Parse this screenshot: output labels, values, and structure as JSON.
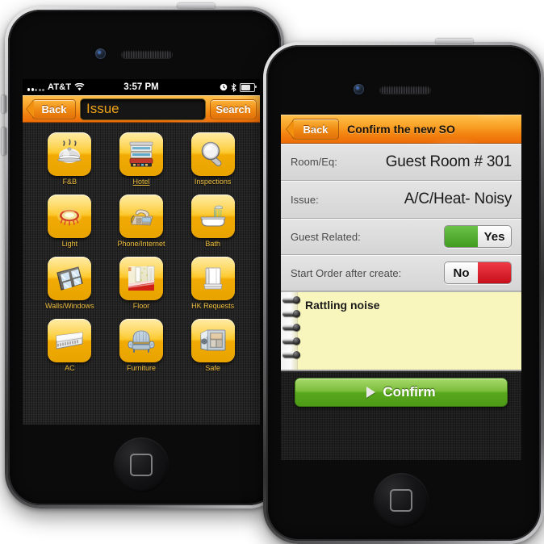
{
  "left_phone": {
    "status_bar": {
      "signal_icon": "signal-bars-icon",
      "carrier": "AT&T",
      "wifi_icon": "wifi-icon",
      "time": "3:57 PM",
      "alarm_icon": "alarm-clock-icon",
      "bluetooth_icon": "bluetooth-icon",
      "battery_icon": "battery-icon"
    },
    "nav": {
      "back_label": "Back",
      "search_value": "Issue",
      "search_placeholder": "Issue",
      "search_label": "Search"
    },
    "grid": [
      {
        "label": "F&B",
        "icon": "food-cloche-icon",
        "selected": false
      },
      {
        "label": "Hotel",
        "icon": "hotel-bed-icon",
        "selected": true
      },
      {
        "label": "Inspections",
        "icon": "magnifier-icon",
        "selected": false
      },
      {
        "label": "Light",
        "icon": "ceiling-light-icon",
        "selected": false
      },
      {
        "label": "Phone/Internet",
        "icon": "desk-phone-icon",
        "selected": false
      },
      {
        "label": "Bath",
        "icon": "bathtub-shower-icon",
        "selected": false
      },
      {
        "label": "Walls/Windows",
        "icon": "window-pane-icon",
        "selected": false
      },
      {
        "label": "Floor",
        "icon": "floor-carpet-icon",
        "selected": false
      },
      {
        "label": "HK Requests",
        "icon": "folded-towels-icon",
        "selected": false
      },
      {
        "label": "AC",
        "icon": "air-conditioner-icon",
        "selected": false
      },
      {
        "label": "Furniture",
        "icon": "armchair-icon",
        "selected": false
      },
      {
        "label": "Safe",
        "icon": "safe-box-icon",
        "selected": false
      }
    ],
    "home_button_icon": "home-button-icon"
  },
  "right_phone": {
    "nav": {
      "back_label": "Back",
      "title": "Confirm the new SO"
    },
    "rows": [
      {
        "label": "Room/Eq:",
        "value": "Guest Room # 301",
        "type": "text"
      },
      {
        "label": "Issue:",
        "value": "A/C/Heat- Noisy",
        "type": "text"
      }
    ],
    "toggles": [
      {
        "label": "Guest Related:",
        "value": "Yes",
        "state": "on",
        "color": "#4fae28"
      },
      {
        "label": "Start Order after create:",
        "value": "No",
        "state": "off",
        "color": "#d6131f"
      }
    ],
    "note": {
      "text": "Rattling noise",
      "rings": 5
    },
    "confirm": {
      "label": "Confirm",
      "icon": "play-triangle-icon"
    },
    "home_button_icon": "home-button-icon"
  }
}
